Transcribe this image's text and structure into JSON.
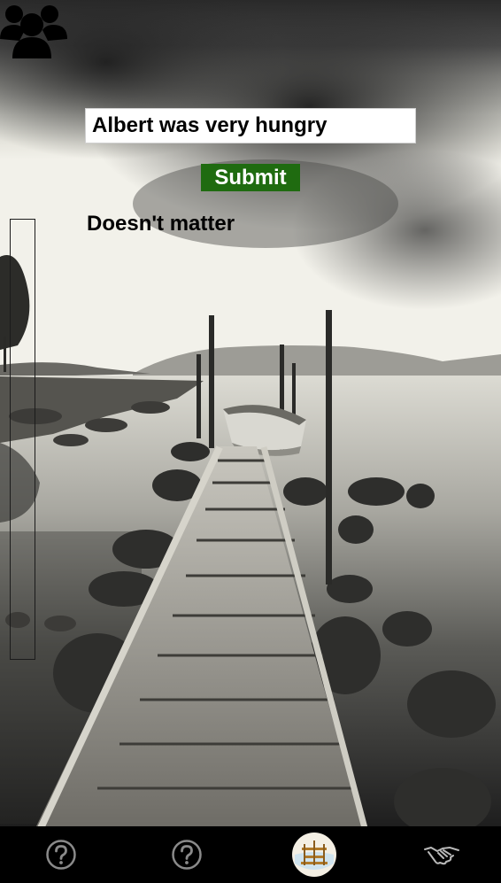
{
  "header": {
    "icon": "people-group-icon"
  },
  "form": {
    "input_value": "Albert was very hungry",
    "submit_label": "Submit",
    "result_text": "Doesn't matter"
  },
  "tabbar": {
    "items": [
      {
        "icon": "help-icon"
      },
      {
        "icon": "help-icon"
      },
      {
        "icon": "pier-avatar-icon"
      },
      {
        "icon": "handshake-icon"
      }
    ]
  },
  "colors": {
    "submit_bg": "#1f6b10",
    "tabbar_bg": "#000000",
    "icon_gray": "#8a8a8a"
  }
}
